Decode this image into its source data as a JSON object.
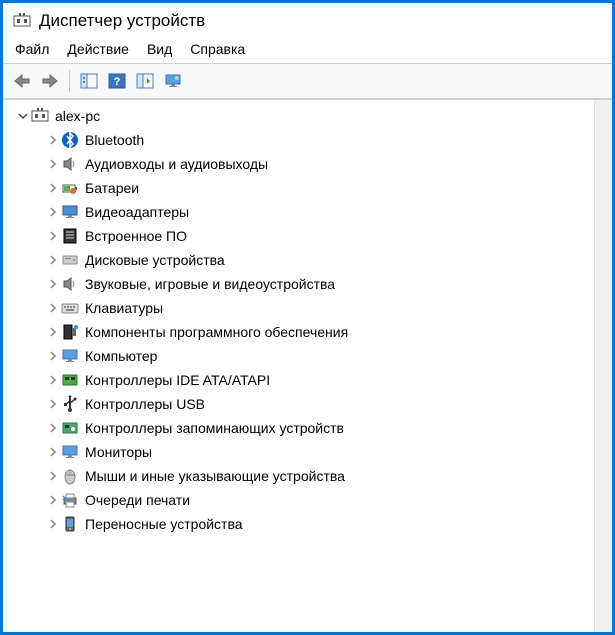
{
  "window": {
    "title": "Диспетчер устройств"
  },
  "menu": {
    "file": "Файл",
    "action": "Действие",
    "view": "Вид",
    "help": "Справка"
  },
  "tree": {
    "root": "alex-pc",
    "items": [
      {
        "icon": "bluetooth",
        "label": "Bluetooth"
      },
      {
        "icon": "speaker",
        "label": "Аудиовходы и аудиовыходы"
      },
      {
        "icon": "battery",
        "label": "Батареи"
      },
      {
        "icon": "display",
        "label": "Видеоадаптеры"
      },
      {
        "icon": "firmware",
        "label": "Встроенное ПО"
      },
      {
        "icon": "disk",
        "label": "Дисковые устройства"
      },
      {
        "icon": "speaker",
        "label": "Звуковые, игровые и видеоустройства"
      },
      {
        "icon": "keyboard",
        "label": "Клавиатуры"
      },
      {
        "icon": "component",
        "label": "Компоненты программного обеспечения"
      },
      {
        "icon": "monitor",
        "label": "Компьютер"
      },
      {
        "icon": "ide",
        "label": "Контроллеры IDE ATA/ATAPI"
      },
      {
        "icon": "usb",
        "label": "Контроллеры USB"
      },
      {
        "icon": "storage",
        "label": "Контроллеры запоминающих устройств"
      },
      {
        "icon": "monitor",
        "label": "Мониторы"
      },
      {
        "icon": "mouse",
        "label": "Мыши и иные указывающие устройства"
      },
      {
        "icon": "print",
        "label": "Очереди печати"
      },
      {
        "icon": "portable",
        "label": "Переносные устройства"
      }
    ]
  }
}
